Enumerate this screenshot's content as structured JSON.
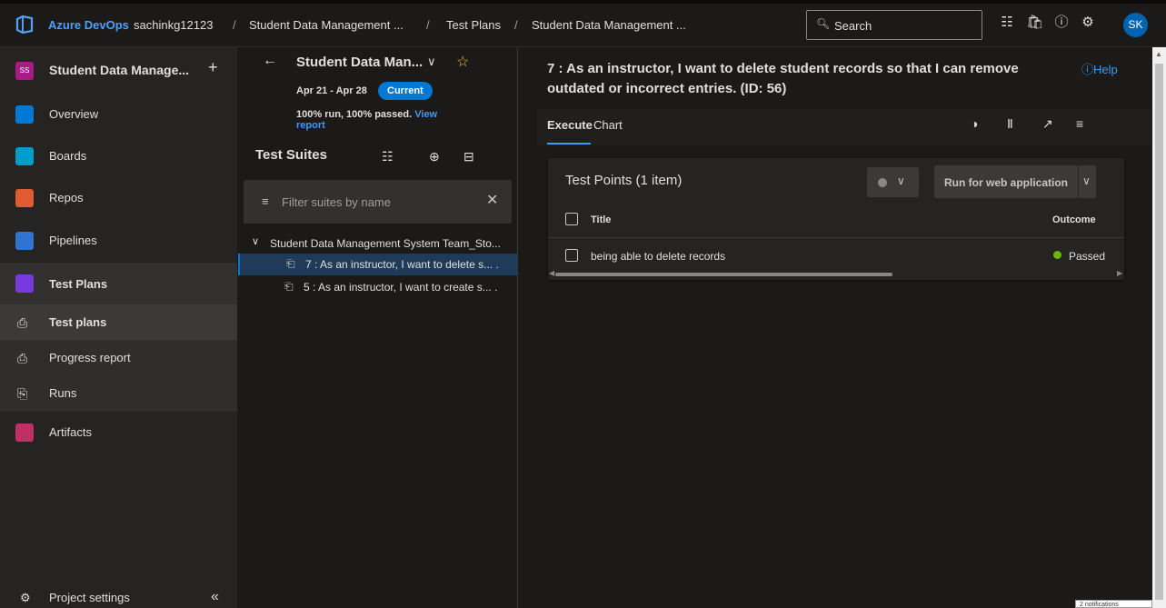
{
  "topbar": {
    "brand": "Azure DevOps",
    "org": "sachinkg12123",
    "sep": "/",
    "crumb_project": "Student Data Management ...",
    "crumb_section": "Test Plans",
    "crumb_plan": "Student Data Management ...",
    "search_placeholder": "Search",
    "avatar_initials": "SK",
    "icons": [
      "azure-devops-logo-icon",
      "search-icon",
      "task-list-icon",
      "shopping-bag-icon",
      "help-icon",
      "user-settings-icon"
    ]
  },
  "nav": {
    "project_initials": "SS",
    "project_name": "Student Data Manage...",
    "add_label": "+",
    "items": [
      {
        "label": "Overview",
        "color": "#0078d4"
      },
      {
        "label": "Boards",
        "color": "#009ccc"
      },
      {
        "label": "Repos",
        "color": "#e05b2f"
      },
      {
        "label": "Pipelines",
        "color": "#2f74d0"
      },
      {
        "label": "Test Plans",
        "color": "#773adc"
      },
      {
        "label": "Artifacts",
        "color": "#c12f67"
      }
    ],
    "test_plans_sub": [
      "Test plans",
      "Progress report",
      "Runs"
    ],
    "settings_label": "Project settings",
    "collapse_label": "«"
  },
  "plan": {
    "title": "Student Data Man...",
    "dates": "Apr 21 - Apr 28",
    "badge": "Current",
    "run_summary": "100% run, 100% passed.",
    "report_link": "View report"
  },
  "suites": {
    "header": "Test Suites",
    "filter_placeholder": "Filter suites by name",
    "root": "Student Data Management System Team_Sto...",
    "children": [
      "7 : As an instructor, I want to delete s... .",
      "5 : As an instructor, I want to create s... ."
    ]
  },
  "workitem": {
    "title": "7 : As an instructor, I want to delete student records so that I can remove outdated or incorrect entries. (ID: 56)",
    "help": "ⓘHelp",
    "tabs": [
      "Execute",
      "Chart"
    ]
  },
  "test_points": {
    "title": "Test Points (1 item)",
    "run_button": "Run for web application",
    "col_title": "Title",
    "col_outcome": "Outcome",
    "rows": [
      {
        "title": "being able to delete records",
        "outcome": "Passed",
        "outcome_color": "#6bb700"
      }
    ]
  },
  "tooltip": "2 notifications"
}
